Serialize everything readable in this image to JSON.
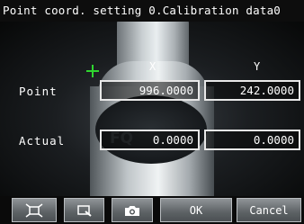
{
  "header": {
    "title": "Point coord. setting 0.Calibration data0"
  },
  "grid": {
    "columns": {
      "x": "X",
      "y": "Y"
    },
    "rows": {
      "point": {
        "label": "Point",
        "x": "996.0000",
        "y": "242.0000"
      },
      "actual": {
        "label": "Actual",
        "x": "0.0000",
        "y": "0.0000"
      }
    }
  },
  "camera": {
    "brand": "FQ"
  },
  "toolbar": {
    "icons": [
      "fit-frame-icon",
      "zoom-icon",
      "camera-icon"
    ],
    "ok_label": "OK",
    "cancel_label": "Cancel"
  },
  "colors": {
    "crosshair": "#2fd62f",
    "field_border": "#e8e8e8",
    "background": "#000000"
  }
}
